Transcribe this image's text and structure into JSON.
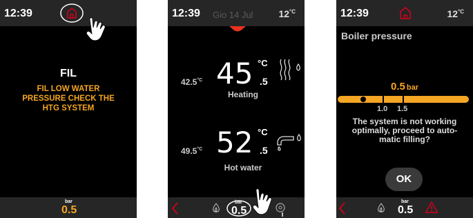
{
  "screen1": {
    "time": "12:39",
    "heading": "FIL",
    "message": "FIL LOW WATER PRESSURE CHECK THE HTG SYSTEM",
    "pressure_unit": "bar",
    "pressure_value": "0.5",
    "icons": [
      "home-icon",
      "tap-hand-icon"
    ]
  },
  "screen2": {
    "time": "12:39",
    "date": "Gio 14 Jul",
    "outdoor_temp": "12",
    "outdoor_unit": "°C",
    "heating": {
      "label": "Heating",
      "temp": "45",
      "decimal": ".5",
      "unit": "°C",
      "setpoint": "42.5",
      "setpoint_unit": "°C"
    },
    "hot_water": {
      "label": "Hot water",
      "temp": "52",
      "decimal": ".5",
      "unit": "°C",
      "setpoint": "49.5",
      "setpoint_unit": "°C"
    },
    "pressure_unit": "bar",
    "pressure_value": "0.5",
    "icons": [
      "back-arrow-icon",
      "flame-icon",
      "tap-hand-icon",
      "settings-icon",
      "radiator-icon",
      "faucet-icon"
    ]
  },
  "screen3": {
    "time": "12:39",
    "outdoor_temp": "12",
    "outdoor_unit": "°C",
    "title": "Boiler pressure",
    "gauge": {
      "value": 0.5,
      "value_label": "0.5",
      "unit": "bar",
      "min": 0,
      "max": 3,
      "tick_labels": [
        "1.0",
        "1.5"
      ]
    },
    "message": "The system is not working optimally, proceed to automatic filling?",
    "message_lines": [
      "The system is not working",
      "optimally, proceed to auto-",
      "matic filling?"
    ],
    "ok_label": "OK",
    "pressure_unit": "bar",
    "pressure_value": "0.5",
    "colors": {
      "accent": "#f5a623",
      "alert": "#d0021b"
    },
    "icons": [
      "home-icon",
      "back-arrow-icon",
      "flame-icon",
      "warning-icon"
    ]
  }
}
